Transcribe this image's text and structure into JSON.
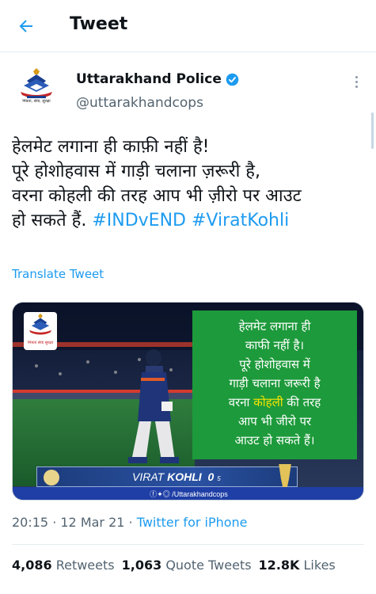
{
  "header": {
    "title": "Tweet"
  },
  "author": {
    "display_name": "Uttarakhand Police",
    "handle": "@uttarakhandcops",
    "avatar_caption": "मित्रता, सेवा, सुरक्षा"
  },
  "tweet": {
    "line1": "हेलमेट लगाना ही काफ़ी नहीं है!",
    "line2": "पूरे होशोहवास में गाड़ी चलाना ज़रूरी है,",
    "line3": "वरना कोहली की तरह आप भी ज़ीरो पर आउट",
    "line4_text": "हो सकते हैं. ",
    "hashtag1": "#INDvEND",
    "hashtag2": "#ViratKohli"
  },
  "translate_label": "Translate Tweet",
  "media": {
    "overlay_lines": [
      "हेलमेट लगाना ही",
      "काफी नहीं है।",
      "पूरे होशोहवास में",
      "गाड़ी चलाना जरूरी है",
      "कोहली",
      "आप भी जीरो पर",
      "आउट हो सकते हैं।"
    ],
    "overlay_line5_pre": "वरना ",
    "overlay_line5_post": " की तरह",
    "scoreboard_name_first": "VIRAT",
    "scoreboard_name_last": "KOHLI",
    "scoreboard_runs": "0",
    "scoreboard_balls": "5",
    "social_handle": "/Uttarakhandcops",
    "logo_caption": "मित्रता सेवा सुरक्षा",
    "colors": {
      "overlay_bg": "#1d9a3b",
      "overlay_text": "#ffffff",
      "highlight": "#f5e400",
      "field": "#1f6b35",
      "stands": "#1c2a4a"
    }
  },
  "meta": {
    "time": "20:15",
    "separator1": " · ",
    "date": "12 Mar 21",
    "separator2": " · ",
    "client": "Twitter for iPhone"
  },
  "stats": {
    "retweets_count": "4,086",
    "retweets_label": "Retweets",
    "quotes_count": "1,063",
    "quotes_label": "Quote Tweets",
    "likes_count": "12.8K",
    "likes_label": "Likes"
  },
  "colors": {
    "accent": "#1d9bf0",
    "text": "#0f1419",
    "secondary": "#536471"
  }
}
